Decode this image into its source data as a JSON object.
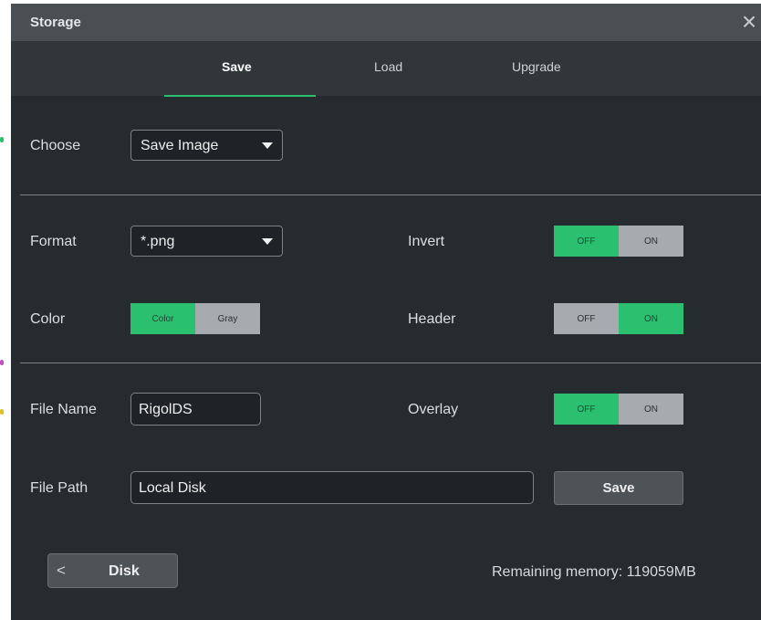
{
  "dialog": {
    "title": "Storage",
    "close_icon": "close-icon"
  },
  "tabs": [
    {
      "label": "Save",
      "active": true
    },
    {
      "label": "Load",
      "active": false
    },
    {
      "label": "Upgrade",
      "active": false
    }
  ],
  "choose": {
    "label": "Choose",
    "value": "Save Image"
  },
  "format": {
    "label": "Format",
    "value": "*.png"
  },
  "invert": {
    "label": "Invert",
    "off": "OFF",
    "on": "ON",
    "state": "OFF"
  },
  "color": {
    "label": "Color",
    "option_a": "Color",
    "option_b": "Gray",
    "selected": "Color"
  },
  "header": {
    "label": "Header",
    "off": "OFF",
    "on": "ON",
    "state": "ON"
  },
  "file_name": {
    "label": "File Name",
    "value": "RigolDS"
  },
  "overlay": {
    "label": "Overlay",
    "off": "OFF",
    "on": "ON",
    "state": "OFF"
  },
  "file_path": {
    "label": "File Path",
    "value": "Local Disk"
  },
  "save_button": "Save",
  "disk_button": {
    "label": "Disk",
    "icon": "chevron-left-icon"
  },
  "remaining": "Remaining memory: 119059MB",
  "colors": {
    "accent": "#2bc06f",
    "background": "#262b30",
    "inactive": "#a7abb0"
  }
}
